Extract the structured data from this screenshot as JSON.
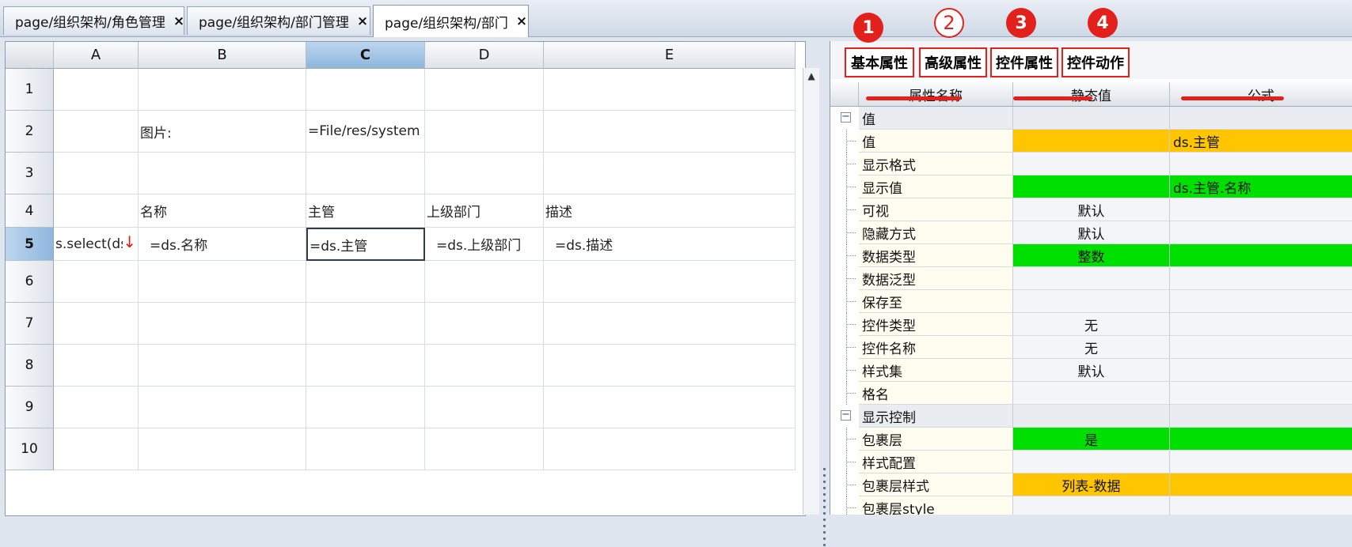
{
  "tabs": [
    {
      "label": "page/组织架构/角色管理",
      "close": "×"
    },
    {
      "label": "page/组织架构/部门管理",
      "close": "×"
    },
    {
      "label": "page/组织架构/部门",
      "close": "×"
    }
  ],
  "sheet": {
    "columns": [
      "A",
      "B",
      "C",
      "D",
      "E"
    ],
    "selected_column": "C",
    "rows": [
      "1",
      "2",
      "3",
      "4",
      "5",
      "6",
      "7",
      "8",
      "9",
      "10"
    ],
    "selected_row": "5",
    "cells": {
      "B2": "图片:",
      "C2": "=File/res/system",
      "B4": "名称",
      "C4": "主管",
      "D4": "上级部门",
      "E4": "描述",
      "A5": "s.select(ds.",
      "B5": "=ds.名称",
      "C5": "=ds.主管",
      "D5": "=ds.上级部门",
      "E5": "=ds.描述"
    }
  },
  "props": {
    "tabs": [
      "基本属性",
      "高级属性",
      "控件属性",
      "控件动作"
    ],
    "badges": [
      "1",
      "2",
      "3",
      "4"
    ],
    "headers": [
      "属性名称",
      "静态值",
      "公式"
    ],
    "rows": [
      {
        "name": "值",
        "static": "",
        "formula": "",
        "group": true
      },
      {
        "name": "值",
        "static": "",
        "formula": "ds.主管",
        "color": "orange"
      },
      {
        "name": "显示格式",
        "static": "",
        "formula": ""
      },
      {
        "name": "显示值",
        "static": "",
        "formula": "ds.主管.名称",
        "color": "green"
      },
      {
        "name": "可视",
        "static": "默认",
        "formula": ""
      },
      {
        "name": "隐藏方式",
        "static": "默认",
        "formula": ""
      },
      {
        "name": "数据类型",
        "static": "整数",
        "formula": "",
        "color": "green"
      },
      {
        "name": "数据泛型",
        "static": "",
        "formula": ""
      },
      {
        "name": "保存至",
        "static": "",
        "formula": ""
      },
      {
        "name": "控件类型",
        "static": "无",
        "formula": ""
      },
      {
        "name": "控件名称",
        "static": "无",
        "formula": ""
      },
      {
        "name": "样式集",
        "static": "默认",
        "formula": ""
      },
      {
        "name": "格名",
        "static": "",
        "formula": ""
      },
      {
        "name": "显示控制",
        "static": "",
        "formula": "",
        "group": true
      },
      {
        "name": "包裹层",
        "static": "是",
        "formula": "",
        "color": "green"
      },
      {
        "name": "样式配置",
        "static": "",
        "formula": ""
      },
      {
        "name": "包裹层样式",
        "static": "列表-数据",
        "formula": "",
        "color": "orange"
      },
      {
        "name": "包裹层style",
        "static": "",
        "formula": ""
      }
    ]
  },
  "colors": {
    "highlight_orange": "#ffc600",
    "highlight_green": "#00e000",
    "annotation_red": "#e2201c"
  }
}
